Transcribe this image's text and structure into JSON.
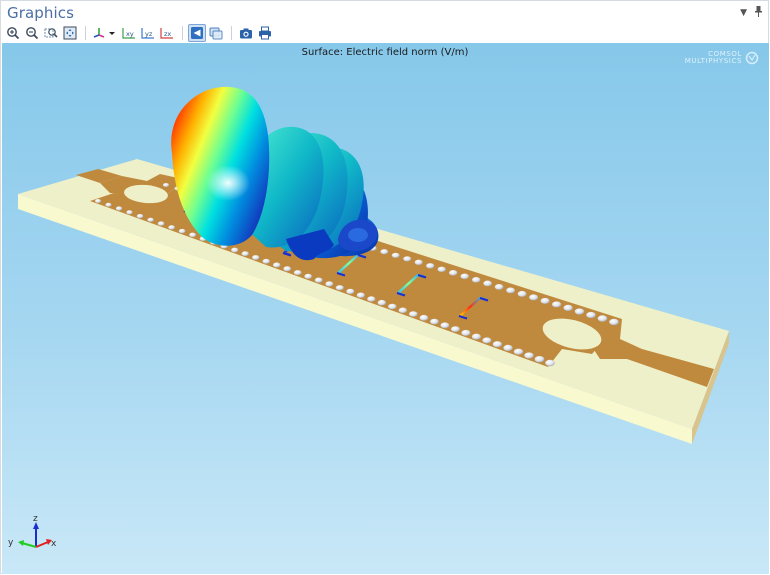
{
  "window": {
    "title": "Graphics",
    "controls": [
      {
        "name": "dropdown-arrow-icon",
        "glyph": "▾"
      },
      {
        "name": "pin-icon",
        "glyph": "📌"
      }
    ]
  },
  "toolbar": {
    "groups": [
      [
        {
          "name": "zoom-in-button",
          "icon": "zoom-in-icon",
          "tooltip": "Zoom In"
        },
        {
          "name": "zoom-out-button",
          "icon": "zoom-out-icon",
          "tooltip": "Zoom Out"
        },
        {
          "name": "zoom-box-button",
          "icon": "zoom-box-icon",
          "tooltip": "Zoom Box"
        },
        {
          "name": "zoom-extents-button",
          "icon": "zoom-extents-icon",
          "tooltip": "Zoom Extents"
        }
      ],
      [
        {
          "name": "go-to-default-view-button",
          "icon": "axes-view-icon",
          "tooltip": "Go to Default View",
          "has_dropdown": true
        },
        {
          "name": "xy-view-button",
          "icon": "xy-plane-icon",
          "label": "xy"
        },
        {
          "name": "yz-view-button",
          "icon": "yz-plane-icon",
          "label": "yz"
        },
        {
          "name": "zx-view-button",
          "icon": "zx-plane-icon",
          "label": "zx"
        }
      ],
      [
        {
          "name": "scene-light-button",
          "icon": "scene-light-icon",
          "active": true
        },
        {
          "name": "transparency-button",
          "icon": "transparency-icon",
          "active": false
        }
      ],
      [
        {
          "name": "image-snapshot-button",
          "icon": "camera-icon"
        },
        {
          "name": "print-button",
          "icon": "printer-icon"
        }
      ]
    ]
  },
  "viewport": {
    "plot_title": "Surface: Electric field norm (V/m)",
    "logo": {
      "line1": "COMSOL",
      "line2": "MULTIPHYSICS"
    },
    "axes": {
      "x": "x",
      "y": "y",
      "z": "z"
    },
    "colors": {
      "substrate_top": "#eef0c9",
      "substrate_side": "#f8f9cf",
      "copper": "#c08a3e",
      "via": "#e4e6ea",
      "axis_x": "#e02020",
      "axis_y": "#22cc22",
      "axis_z": "#1a2ed0"
    },
    "model": {
      "description": "Substrate integrated waveguide slot antenna with far-field radiation pattern",
      "slots": [
        {
          "field_level": "low"
        },
        {
          "field_level": "low"
        },
        {
          "field_level": "low"
        },
        {
          "field_level": "medium"
        },
        {
          "field_level": "medium"
        },
        {
          "field_level": "high"
        }
      ]
    }
  }
}
